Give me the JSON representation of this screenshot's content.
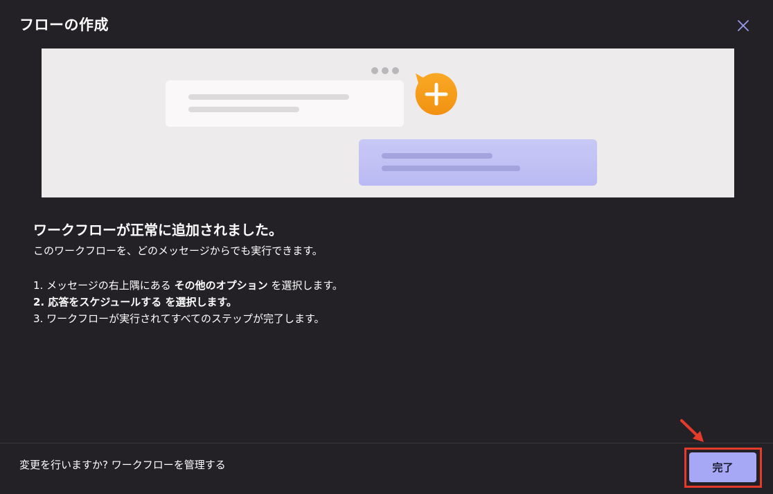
{
  "dialog": {
    "title": "フローの作成",
    "close_icon": "close-icon"
  },
  "illustration": {
    "plus_icon": "plus-icon",
    "colors": {
      "background": "#edebec",
      "card_white": "#faf8f8",
      "card_purple": "#c2c2f5",
      "plus_bubble": "#f7a21b"
    }
  },
  "content": {
    "headline": "ワークフローが正常に追加されました。",
    "subtext": "このワークフローを、どのメッセージからでも実行できます。",
    "step1_prefix": "1. メッセージの右上隅にある ",
    "step1_bold": "その他のオプション",
    "step1_suffix": " を選択します。",
    "step2": "2. 応答をスケジュールする を選択します。",
    "step3": "3. ワークフローが実行されてすべてのステップが完了します。"
  },
  "footer": {
    "question": "変更を行いますか? ",
    "manage_link": "ワークフローを管理する",
    "done_label": "完了"
  },
  "colors": {
    "background": "#232126",
    "accent_button": "#a6a7f5",
    "highlight_box": "#e53b2a",
    "close_icon": "#9a9cf0"
  }
}
